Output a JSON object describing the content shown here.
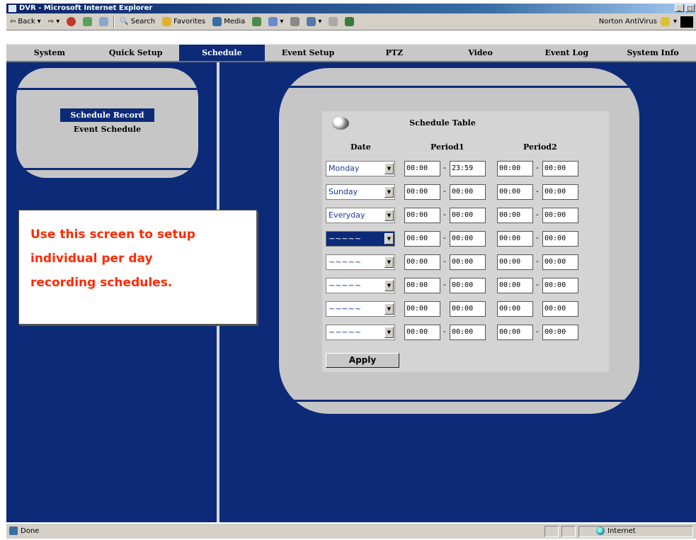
{
  "window": {
    "title": "DVR - Microsoft Internet Explorer"
  },
  "ie_toolbar": {
    "back": "Back",
    "search": "Search",
    "favorites": "Favorites",
    "media": "Media",
    "norton": "Norton AntiVirus"
  },
  "nav": {
    "items": [
      "System",
      "Quick Setup",
      "Schedule",
      "Event Setup",
      "PTZ",
      "Video",
      "Event Log",
      "System Info"
    ],
    "active": "Schedule"
  },
  "submenu": {
    "schedule_record": "Schedule Record",
    "event_schedule": "Event Schedule"
  },
  "note": {
    "line1": "Use this screen to setup",
    "line2": "individual per day",
    "line3": "recording schedules."
  },
  "schedule": {
    "title": "Schedule Table",
    "col_date": "Date",
    "col_period1": "Period1",
    "col_period2": "Period2",
    "dash": "-",
    "rows": [
      {
        "day": "Monday",
        "p1s": "00:00",
        "p1e": "23:59",
        "p2s": "00:00",
        "p2e": "00:00"
      },
      {
        "day": "Sunday",
        "p1s": "00:00",
        "p1e": "00:00",
        "p2s": "00:00",
        "p2e": "00:00"
      },
      {
        "day": "Everyday",
        "p1s": "00:00",
        "p1e": "00:00",
        "p2s": "00:00",
        "p2e": "00:00"
      },
      {
        "day": "~~~~~",
        "p1s": "00:00",
        "p1e": "00:00",
        "p2s": "00:00",
        "p2e": "00:00"
      },
      {
        "day": "~~~~~",
        "p1s": "00:00",
        "p1e": "00:00",
        "p2s": "00:00",
        "p2e": "00:00"
      },
      {
        "day": "~~~~~",
        "p1s": "00:00",
        "p1e": "00:00",
        "p2s": "00:00",
        "p2e": "00:00"
      },
      {
        "day": "~~~~~",
        "p1s": "00:00",
        "p1e": "00:00",
        "p2s": "00:00",
        "p2e": "00:00"
      },
      {
        "day": "~~~~~",
        "p1s": "00:00",
        "p1e": "00:00",
        "p2s": "00:00",
        "p2e": "00:00"
      }
    ],
    "apply": "Apply"
  },
  "status": {
    "left": "Done",
    "zone": "Internet"
  },
  "colors": {
    "navy": "#0c2a78",
    "panel": "#c6c6c6",
    "note_text": "#ff2a00"
  },
  "icons": [
    "ie-icon",
    "back-icon",
    "forward-icon",
    "stop-icon",
    "refresh-icon",
    "home-icon",
    "search-icon",
    "favorites-icon",
    "media-icon",
    "history-icon",
    "mail-icon",
    "print-icon",
    "edit-icon",
    "schedule-knob-icon",
    "dropdown-arrow-icon",
    "globe-icon"
  ]
}
